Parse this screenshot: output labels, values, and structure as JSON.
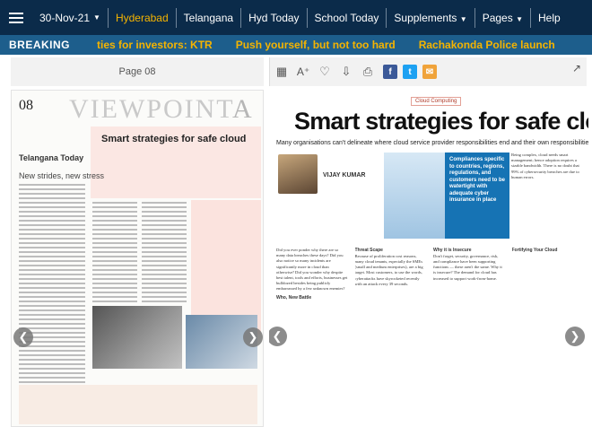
{
  "topnav": {
    "date": "30-Nov-21",
    "items": [
      "Hyderabad",
      "Telangana",
      "Hyd Today",
      "School Today",
      "Supplements",
      "Pages",
      "Help"
    ]
  },
  "breaking": {
    "label": "BREAKING",
    "ticker": [
      "ties for investors: KTR",
      "Push yourself, but not too hard",
      "Rachakonda Police launch"
    ]
  },
  "viewer": {
    "left_page_label": "Page 08",
    "left_page_number": "08",
    "left_page_section": "VIEWPOINT",
    "left_masthead": "Telangana Today",
    "left_mini_headline": "Smart strategies for safe cloud",
    "left_col_title": "New strides, new stress"
  },
  "article": {
    "tag": "Cloud Computing",
    "headline": "Smart strategies for safe cloud",
    "subhead": "Many organisations can't delineate where cloud service provider responsibilities end and their own responsibilities begin",
    "author": "VIJAY KUMAR",
    "pullquote": "Compliances specific to countries, regions, regulations, and customers need to be watertight with adequate cyber insurance in place",
    "col1_title": "Who, New Battle",
    "col1": "Did you ever ponder why there are so many data breaches these days? Did you also notice so many incidents are significantly more in cloud than otherwise? Did you wonder why despite best talent, tools and efforts, businesses get bulldozed besides being publicly embarrassed by a few unknown enemies?",
    "col2_title": "Threat Scape",
    "col2": "Because of proliferation cost reasons, many cloud tenants, especially the SMEs (small and medium enterprises), are a big target. Most customers, to use the words, cyberattacks have skyrocketed recently with an attack every 39 seconds.",
    "col3_title": "Why it is Insecure",
    "col3": "Don't forget, security, governance, risk, and compliance have been supporting functions — these aren't the same. Why it is insecure? The demand for cloud has increased to support work-from-home.",
    "col4_title": "Fortifying Your Cloud",
    "col4": "Being complex, cloud needs smart management; hence adoption requires a sizable bandwidth. There is no doubt that 99% of cybersecurity breaches are due to human errors."
  }
}
